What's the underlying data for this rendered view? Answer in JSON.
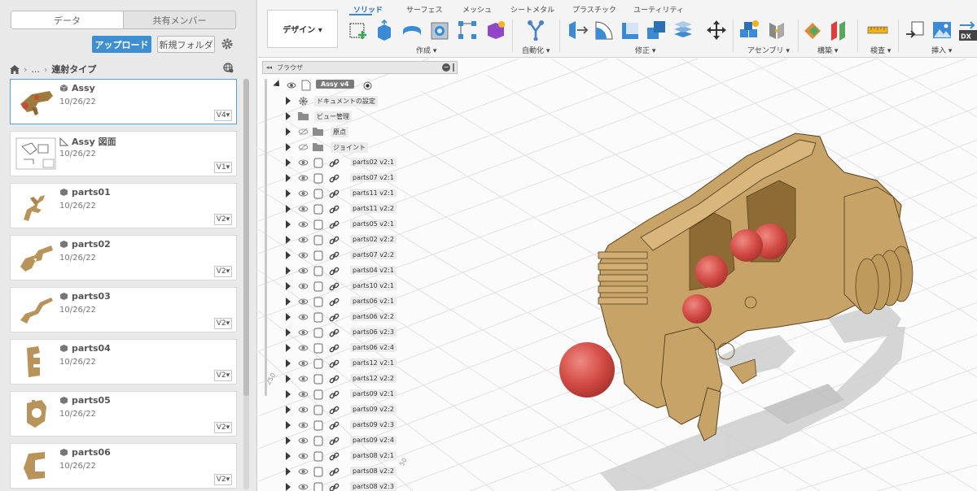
{
  "datapanel": {
    "tabs": [
      "データ",
      "共有メンバー"
    ],
    "upload_label": "アップロード",
    "new_folder_label": "新規フォルダ",
    "breadcrumb": {
      "ellipsis": "...",
      "title": "連射タイプ"
    },
    "items": [
      {
        "name": "Assy",
        "date": "10/26/22",
        "version": "V4",
        "type": "assembly"
      },
      {
        "name": "Assy 図面",
        "date": "10/26/22",
        "version": "V1",
        "type": "drawing"
      },
      {
        "name": "parts01",
        "date": "10/26/22",
        "version": "V2",
        "type": "part"
      },
      {
        "name": "parts02",
        "date": "10/26/22",
        "version": "V2",
        "type": "part"
      },
      {
        "name": "parts03",
        "date": "10/26/22",
        "version": "V2",
        "type": "part"
      },
      {
        "name": "parts04",
        "date": "10/26/22",
        "version": "V2",
        "type": "part"
      },
      {
        "name": "parts05",
        "date": "10/26/22",
        "version": "V2",
        "type": "part"
      },
      {
        "name": "parts06",
        "date": "10/26/22",
        "version": "V2",
        "type": "part"
      }
    ]
  },
  "toolbar": {
    "workspace": "デザイン ▾",
    "tabs": [
      "ソリッド",
      "サーフェス",
      "メッシュ",
      "シートメタル",
      "プラスチック",
      "ユーティリティ"
    ],
    "groups": [
      "作成 ▾",
      "自動化 ▾",
      "修正 ▾",
      "アセンブリ ▾",
      "構築 ▾",
      "検査 ▾",
      "挿入 ▾"
    ]
  },
  "browser": {
    "title": "ブラウザ",
    "root": "Assy v4",
    "folders": [
      "ドキュメントの設定",
      "ビュー管理",
      "原点",
      "ジョイント"
    ],
    "parts": [
      "parts02 v2:1",
      "parts07 v2:1",
      "parts11 v2:1",
      "parts11 v2:2",
      "parts05 v2:1",
      "parts02 v2:2",
      "parts07 v2:2",
      "parts04 v2:1",
      "parts10 v2:1",
      "parts06 v2:1",
      "parts06 v2:2",
      "parts06 v2:3",
      "parts06 v2:4",
      "parts12 v2:1",
      "parts12 v2:2",
      "parts09 v2:1",
      "parts09 v2:2",
      "parts09 v2:3",
      "parts09 v2:4",
      "parts08 v2:1",
      "parts08 v2:2",
      "parts08 v2:3"
    ]
  },
  "viewport": {
    "grid_label_a": "250",
    "grid_label_b": "50",
    "model_color": "#c8a368",
    "ball_color": "#d24a44"
  },
  "colors": {
    "accent": "#3d8fd1",
    "tab_active": "#1f6fbf"
  }
}
